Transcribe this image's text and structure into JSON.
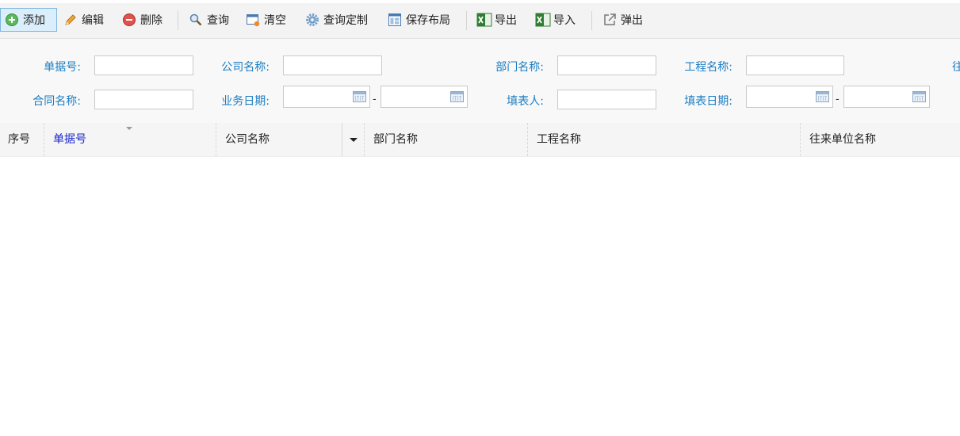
{
  "toolbar": {
    "add": "添加",
    "edit": "编辑",
    "delete": "删除",
    "query": "查询",
    "clear": "清空",
    "query_custom": "查询定制",
    "save_layout": "保存布局",
    "export": "导出",
    "import": "导入",
    "popup": "弹出",
    "icons": [
      "add-icon",
      "pencil-icon",
      "delete-icon",
      "magnifier-icon",
      "clear-window-icon",
      "gear-icon",
      "layout-icon",
      "excel-export-icon",
      "excel-import-icon",
      "popup-icon"
    ]
  },
  "query_form": {
    "doc_no_label": "单据号:",
    "company_label": "公司名称:",
    "dept_label": "部门名称:",
    "project_label": "工程名称:",
    "partner_label_partial": "往",
    "contract_label": "合同名称:",
    "biz_date_label": "业务日期:",
    "filler_label": "填表人:",
    "fill_date_label": "填表日期:",
    "range_sep": "-",
    "doc_no_value": "",
    "company_value": "",
    "dept_value": "",
    "project_value": "",
    "contract_value": "",
    "biz_date_from": "",
    "biz_date_to": "",
    "filler_value": "",
    "fill_date_from": "",
    "fill_date_to": ""
  },
  "grid": {
    "columns": [
      "序号",
      "单据号",
      "公司名称",
      "部门名称",
      "工程名称",
      "往来单位名称"
    ],
    "sorted_column": "单据号",
    "rows": []
  },
  "colors": {
    "label_blue": "#1b7dc2",
    "sorted_header": "#1a28c8",
    "toolbar_bg": "#f3f3f3",
    "active_button_bg": "#dbeefb"
  }
}
